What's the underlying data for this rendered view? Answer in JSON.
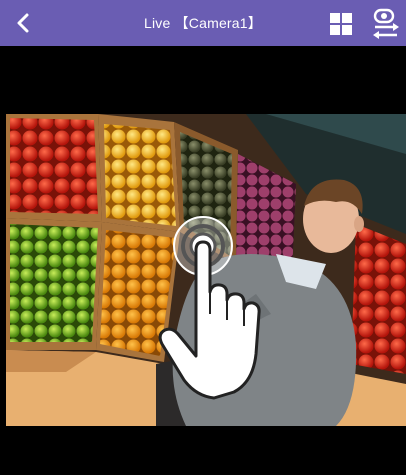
{
  "header": {
    "title": "Live 【Camera1】",
    "back_icon": "chevron-left-icon",
    "grid_icon": "grid-layout-icon",
    "switch_icon": "camera-switch-icon",
    "background_color": "#6a5db3"
  },
  "video": {
    "gesture_icon": "tap-gesture-icon"
  }
}
